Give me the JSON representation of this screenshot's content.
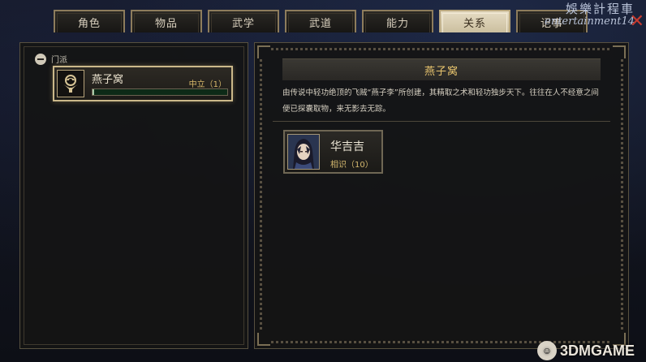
{
  "tabs": [
    {
      "label": "角色",
      "active": false
    },
    {
      "label": "物品",
      "active": false
    },
    {
      "label": "武学",
      "active": false
    },
    {
      "label": "武道",
      "active": false
    },
    {
      "label": "能力",
      "active": false
    },
    {
      "label": "关系",
      "active": true
    },
    {
      "label": "记事",
      "active": false
    }
  ],
  "watermark": {
    "line1": "娛樂計程車",
    "line2": "entertainment14"
  },
  "left_panel": {
    "category": "门派",
    "faction": {
      "name": "燕子窝",
      "standing": "中立（1）",
      "emblem_icon": "swallow-emblem-icon",
      "progress_fraction": 0.01
    }
  },
  "right_panel": {
    "title": "燕子窝",
    "description": "由传说中轻功绝顶的飞贼“燕子李”所创建，其精取之术和轻功独步天下。往往在人不经意之间便已探囊取物，来无影去无踪。",
    "members": [
      {
        "name": "华吉吉",
        "relation": "相识（10）",
        "portrait_icon": "character-portrait-icon"
      }
    ]
  },
  "logo": {
    "text": "3DMGAME"
  },
  "colors": {
    "accent_gold": "#e9c56e",
    "bar_green": "#7fb286",
    "active_tab": "#e6dcc4"
  }
}
